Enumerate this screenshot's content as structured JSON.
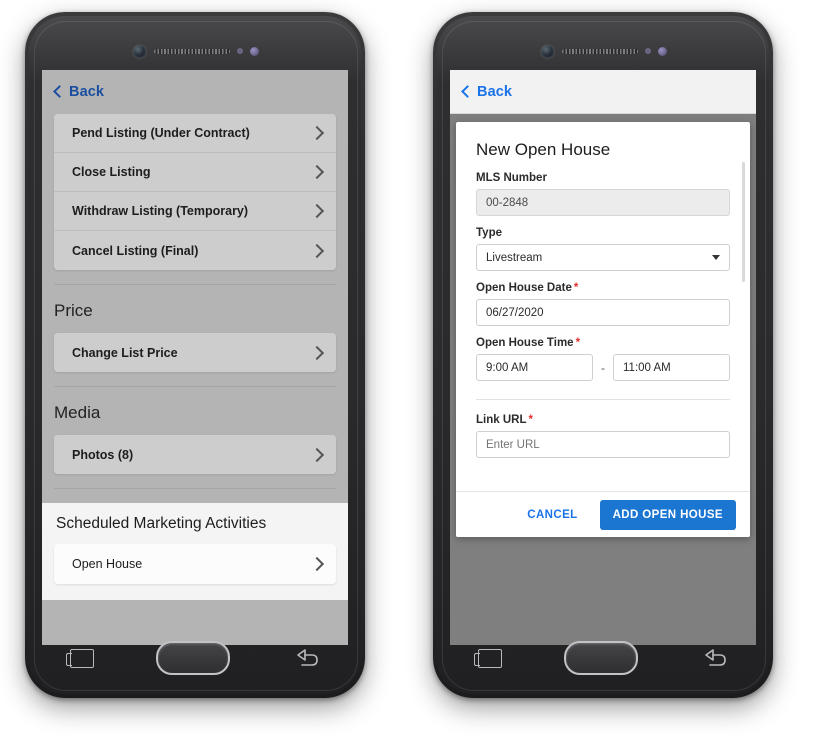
{
  "left_phone": {
    "nav": {
      "back_label": "Back",
      "back_icon": "chevron-left-icon"
    },
    "groups": [
      {
        "rows": [
          {
            "label": "Pend Listing (Under Contract)"
          },
          {
            "label": "Close Listing"
          },
          {
            "label": "Withdraw Listing (Temporary)"
          },
          {
            "label": "Cancel Listing (Final)"
          }
        ]
      }
    ],
    "price_section": {
      "title": "Price",
      "rows": [
        {
          "label": "Change List Price"
        }
      ]
    },
    "media_section": {
      "title": "Media",
      "rows": [
        {
          "label": "Photos (8)"
        }
      ]
    },
    "marketing_section": {
      "title": "Scheduled Marketing Activities",
      "rows": [
        {
          "label": "Open House"
        }
      ]
    }
  },
  "right_phone": {
    "nav": {
      "back_label": "Back",
      "back_icon": "chevron-left-icon"
    },
    "modal": {
      "title": "New Open House",
      "fields": {
        "mls": {
          "label": "MLS Number",
          "value": "00-2848",
          "disabled": true
        },
        "type": {
          "label": "Type",
          "value": "Livestream",
          "caret_icon": "chevron-down-icon"
        },
        "date": {
          "label": "Open House Date",
          "required": "*",
          "value": "06/27/2020"
        },
        "time": {
          "label": "Open House Time",
          "required": "*",
          "start": "9:00 AM",
          "separator": "-",
          "end": "11:00 AM"
        },
        "link_url": {
          "label": "Link URL",
          "required": "*",
          "placeholder": "Enter URL"
        }
      },
      "actions": {
        "cancel_label": "CANCEL",
        "submit_label": "ADD OPEN HOUSE"
      }
    }
  },
  "hardware": {
    "recents_icon": "recents-key-icon",
    "home_icon": "home-key-icon",
    "back_icon": "back-key-icon",
    "camera_icon": "front-camera-icon",
    "speaker_icon": "earpiece-speaker-icon"
  },
  "colors": {
    "accent_blue": "#1b76d2",
    "link_blue": "#1a73e8",
    "nav_blue": "#1a4fa0",
    "required_red": "#e03030",
    "screen_gray": "#b4b4b4",
    "backdrop_gray": "#7f7f7f"
  }
}
